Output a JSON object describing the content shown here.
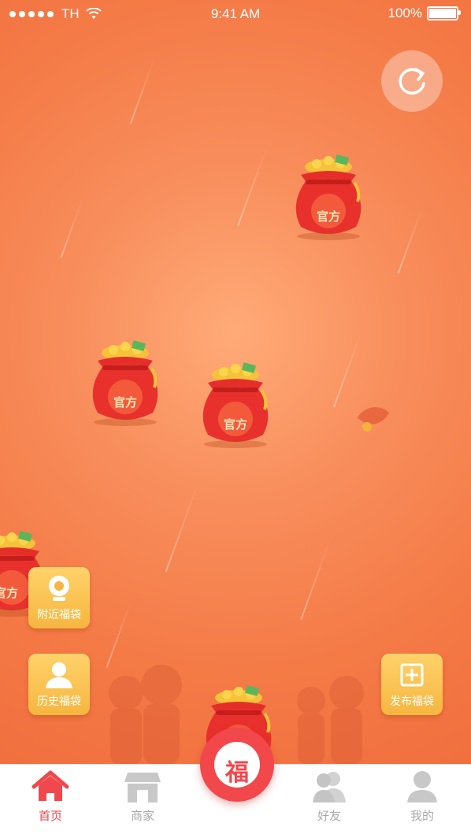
{
  "status_bar": {
    "carrier": "TH",
    "time": "9:41 AM",
    "battery": "100%"
  },
  "icons": {
    "refresh": "refresh-icon",
    "wifi": "wifi-icon",
    "battery": "battery-icon"
  },
  "bags": [
    {
      "label": "官方"
    },
    {
      "label": "官方"
    },
    {
      "label": "官方"
    },
    {
      "label": "官方"
    },
    {
      "label": "官方"
    }
  ],
  "side_buttons": {
    "nearby": "附近福袋",
    "history": "历史福袋",
    "publish": "发布福袋"
  },
  "center_button": {
    "label": "福"
  },
  "tabs": [
    {
      "label": "首页",
      "active": true
    },
    {
      "label": "商家",
      "active": false
    },
    {
      "label": "好友",
      "active": false
    },
    {
      "label": "我的",
      "active": false
    }
  ],
  "colors": {
    "background": "#f47a46",
    "accent": "#f0484c",
    "gold_button": "#f6b640"
  }
}
